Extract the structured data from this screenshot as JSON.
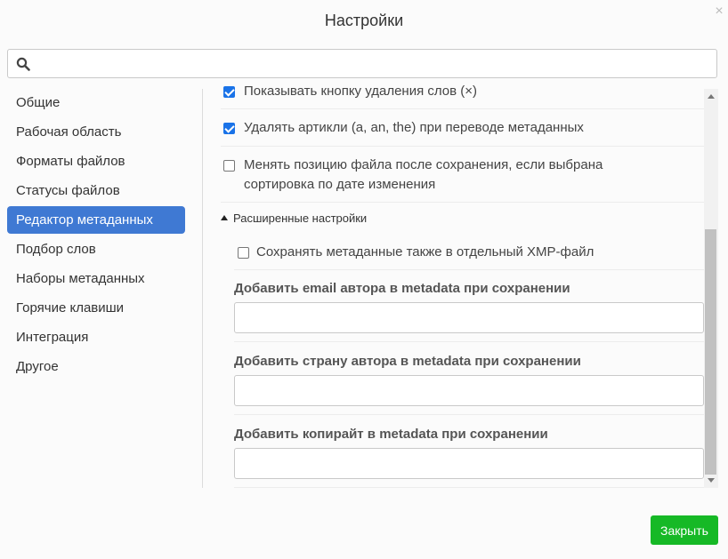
{
  "dialog": {
    "title": "Настройки",
    "close_symbol": "×"
  },
  "search": {
    "value": "",
    "placeholder": ""
  },
  "sidebar": {
    "items": [
      {
        "label": "Общие",
        "active": false
      },
      {
        "label": "Рабочая область",
        "active": false
      },
      {
        "label": "Форматы файлов",
        "active": false
      },
      {
        "label": "Статусы файлов",
        "active": false
      },
      {
        "label": "Редактор метаданных",
        "active": true
      },
      {
        "label": "Подбор слов",
        "active": false
      },
      {
        "label": "Наборы метаданных",
        "active": false
      },
      {
        "label": "Горячие клавиши",
        "active": false
      },
      {
        "label": "Интеграция",
        "active": false
      },
      {
        "label": "Другое",
        "active": false
      }
    ]
  },
  "settings": {
    "show_delete_words": {
      "label": "Показывать кнопку удаления слов (×)",
      "checked": true
    },
    "remove_articles": {
      "label": "Удалять артикли (a, an, the) при переводе метаданных",
      "checked": true
    },
    "change_position": {
      "label_line1": "Менять позицию файла после сохранения, если выбрана",
      "label_line2": "сортировка по дате изменения",
      "checked": false
    },
    "advanced": {
      "toggle_label": "Расширенные настройки",
      "save_xmp": {
        "label": "Сохранять метаданные также в отдельный XMP-файл",
        "checked": false
      },
      "author_email": {
        "label": "Добавить email автора в metadata при сохранении",
        "value": ""
      },
      "author_country": {
        "label": "Добавить страну автора в metadata при сохранении",
        "value": ""
      },
      "copyright": {
        "label": "Добавить копирайт в metadata при сохранении",
        "value": ""
      }
    }
  },
  "footer": {
    "close_label": "Закрыть"
  },
  "colors": {
    "accent": "#3f79d3",
    "checkbox": "#1a73e8",
    "close_button": "#16b926"
  }
}
